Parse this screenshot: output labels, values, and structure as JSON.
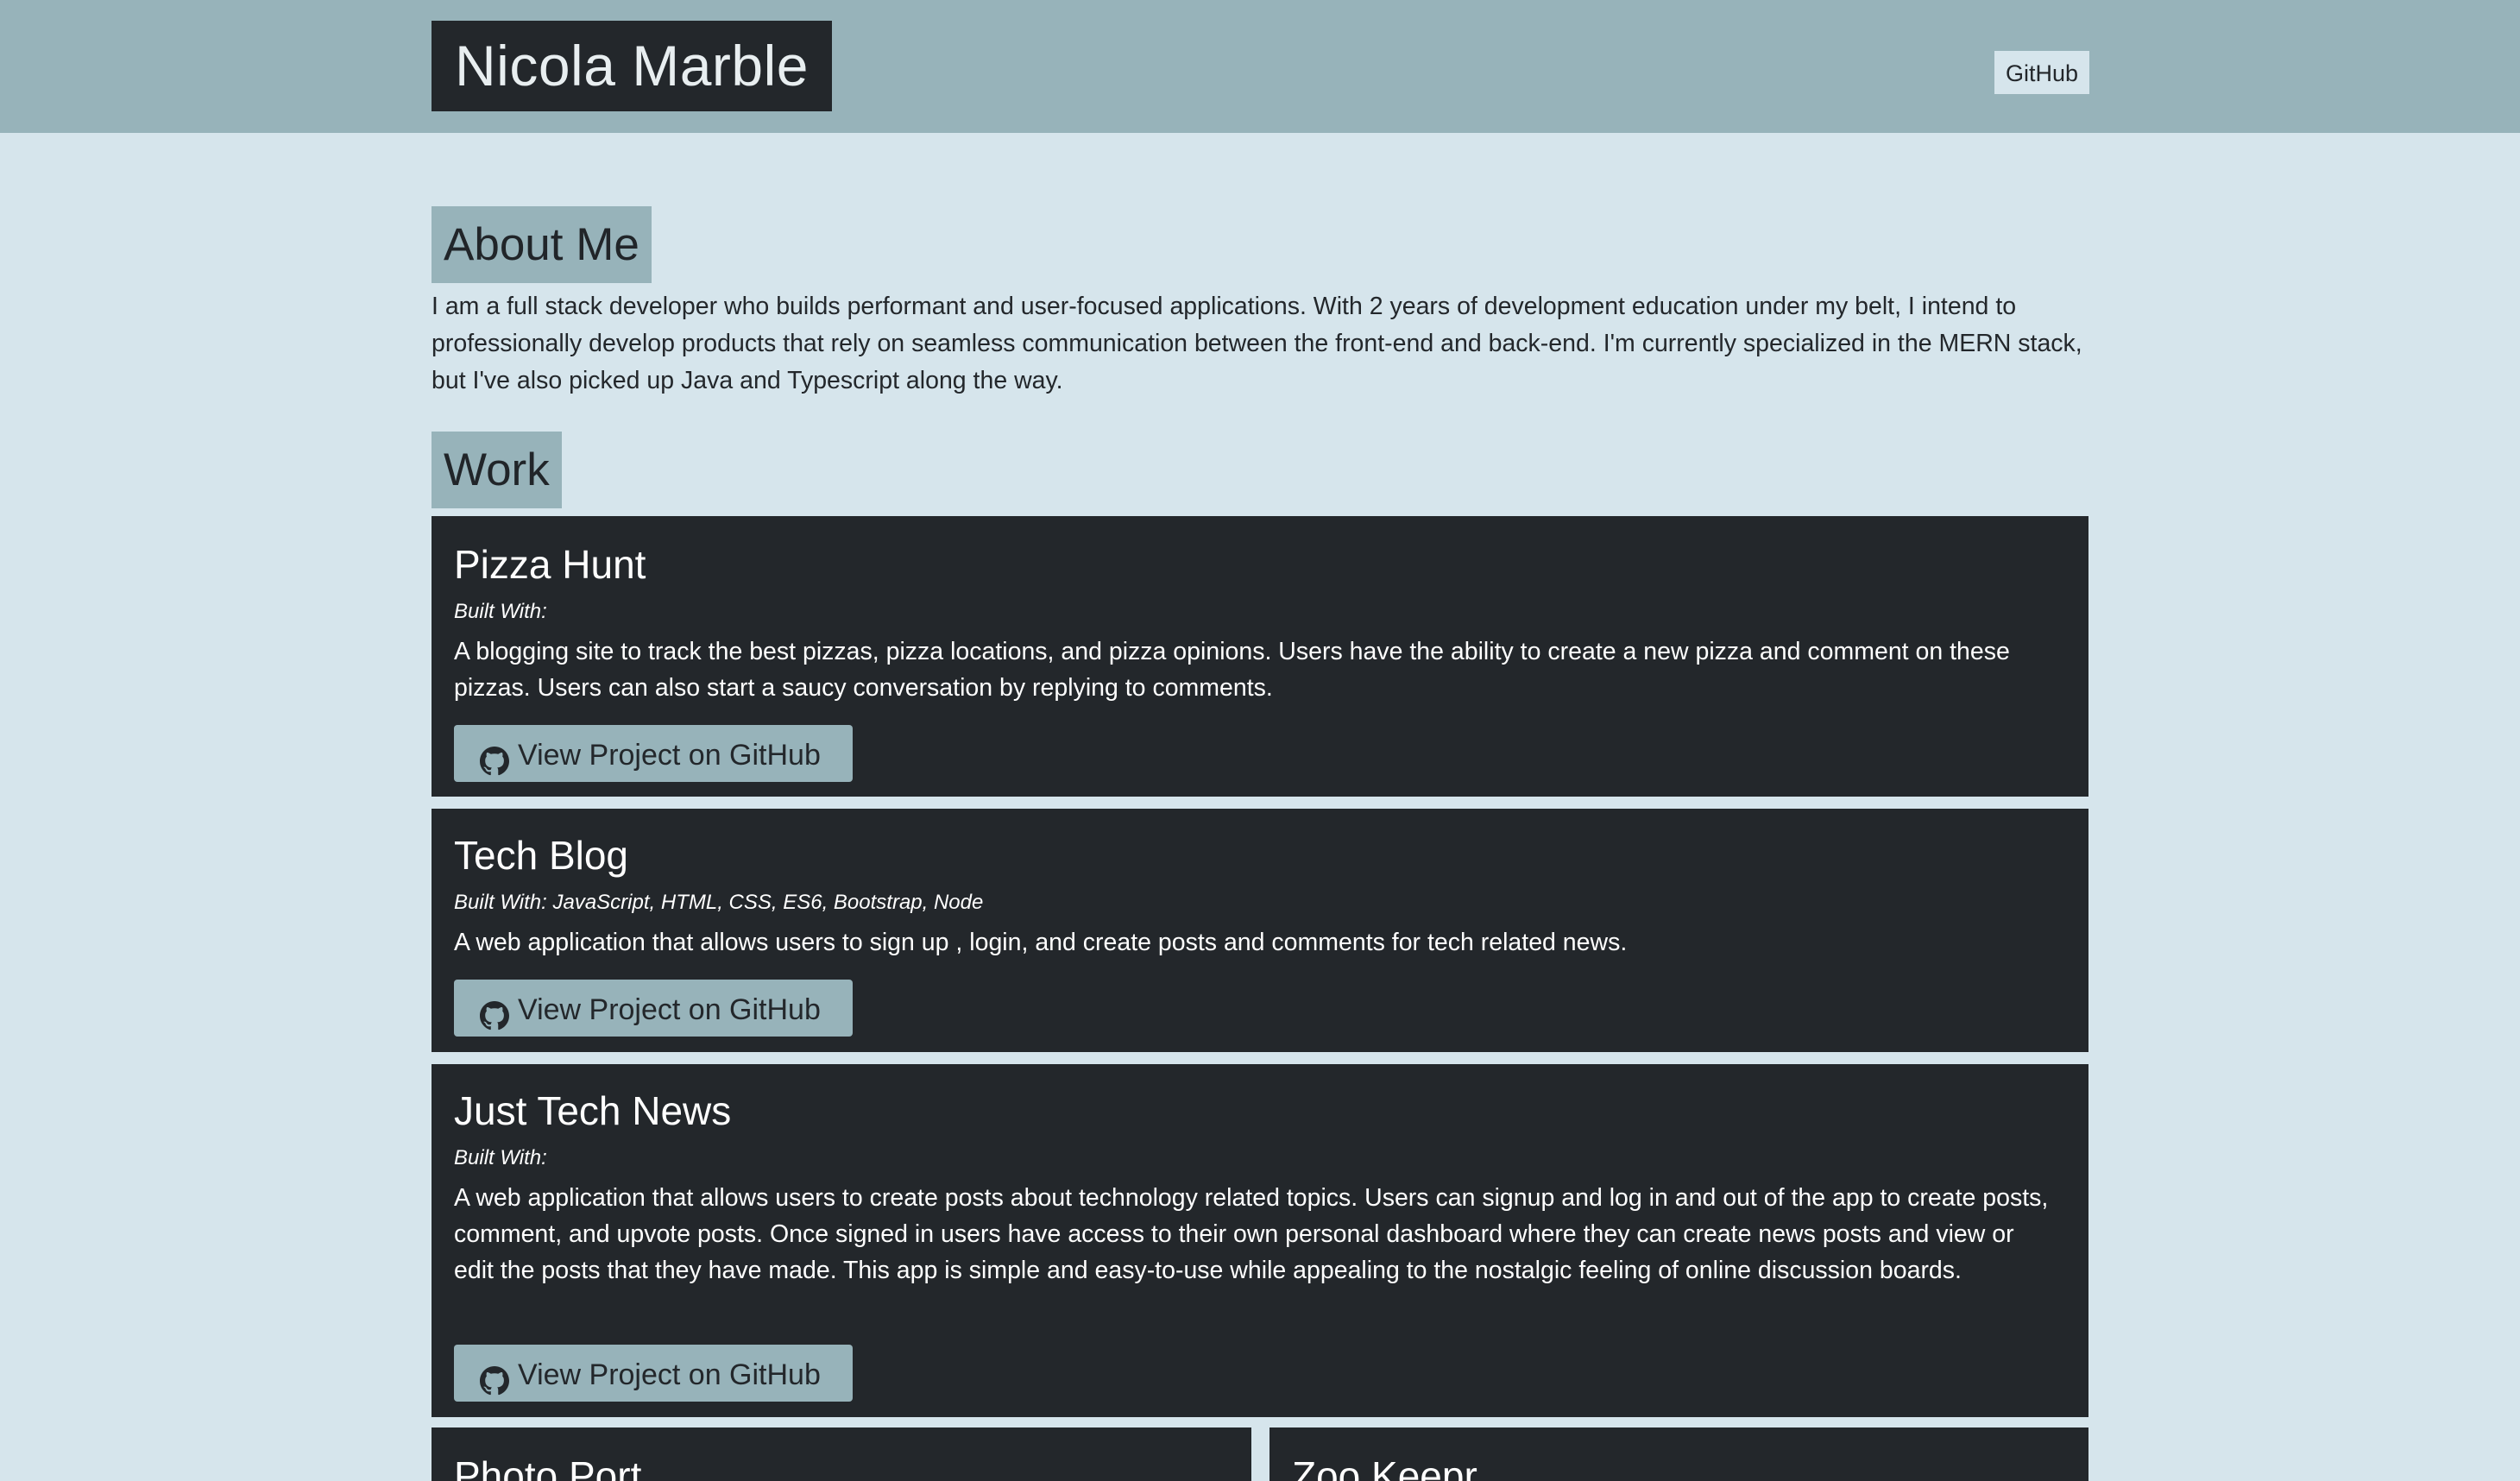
{
  "header": {
    "brand": "Nicola Marble",
    "nav_github": "GitHub"
  },
  "about": {
    "title": "About Me",
    "text": "I am a full stack developer who builds performant and user-focused applications. With 2 years of development education under my belt, I intend to professionally develop products that rely on seamless communication between the front-end and back-end. I'm currently specialized in the MERN stack, but I've also picked up Java and Typescript along the way."
  },
  "work": {
    "title": "Work",
    "button_label": "View Project on GitHub",
    "button_icon": "github-icon",
    "projects": [
      {
        "title": "Pizza Hunt",
        "built_with": "Built With:",
        "description": "A blogging site to track the best pizzas, pizza locations, and pizza opinions. Users have the ability to create a new pizza and comment on these pizzas. Users can also start a saucy conversation by replying to comments."
      },
      {
        "title": "Tech Blog",
        "built_with": "Built With: JavaScript, HTML, CSS, ES6, Bootstrap, Node",
        "description": "A web application that allows users to sign up , login, and create posts and comments for tech related news."
      },
      {
        "title": "Just Tech News",
        "built_with": "Built With:",
        "description": "A web application that allows users to create posts about technology related topics. Users can signup and log in and out of the app to create posts, comment, and upvote posts. Once signed in users have access to their own personal dashboard where they can create news posts and view or edit the posts that they have made. This app is simple and easy-to-use while appealing to the nostalgic feeling of online discussion boards."
      },
      {
        "title": "Photo Port"
      },
      {
        "title": "Zoo Keepr"
      }
    ]
  },
  "colors": {
    "page_bg": "#d6e5ec",
    "header_bg": "#97b3ba",
    "dark": "#23272b",
    "accent": "#97b3ba"
  }
}
